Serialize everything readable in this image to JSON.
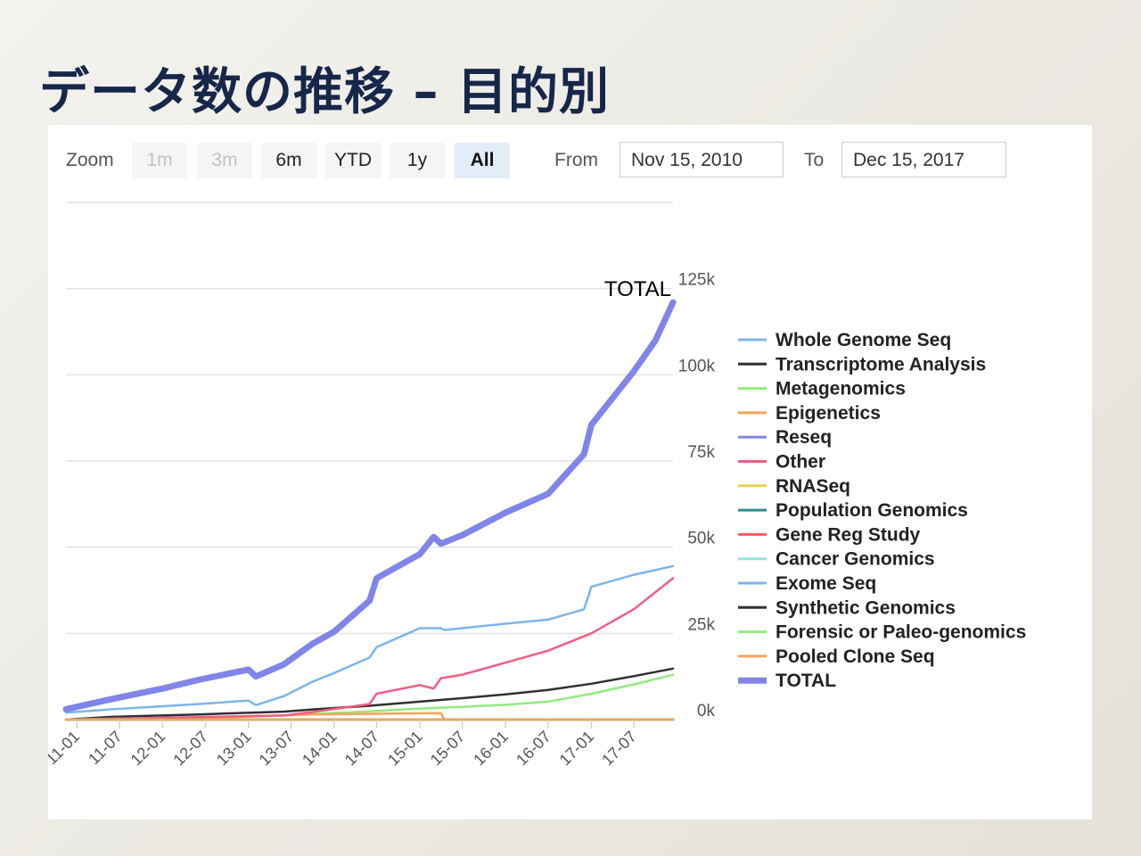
{
  "title": "データ数の推移 – 目的別",
  "toolbar": {
    "zoom_label": "Zoom",
    "buttons": [
      {
        "label": "1m",
        "state": "disabled"
      },
      {
        "label": "3m",
        "state": "disabled"
      },
      {
        "label": "6m",
        "state": "normal"
      },
      {
        "label": "YTD",
        "state": "normal"
      },
      {
        "label": "1y",
        "state": "normal"
      },
      {
        "label": "All",
        "state": "active"
      }
    ],
    "from_label": "From",
    "from_value": "Nov 15, 2010",
    "to_label": "To",
    "to_value": "Dec 15, 2017"
  },
  "chart_data": {
    "type": "line",
    "y_ticks": [
      "0k",
      "25k",
      "50k",
      "75k",
      "100k",
      "125k"
    ],
    "ylim": [
      0,
      150000
    ],
    "x_ticks": [
      "11-01",
      "11-07",
      "12-01",
      "12-07",
      "13-01",
      "13-07",
      "14-01",
      "14-07",
      "15-01",
      "15-07",
      "16-01",
      "16-07",
      "17-01",
      "17-07"
    ],
    "x_domain": [
      "2010-11-15",
      "2017-12-15"
    ],
    "first_tick_partial": "-01",
    "end_label": "TOTAL",
    "grid": true,
    "legend_position": "right",
    "series": [
      {
        "name": "Whole Genome Seq",
        "color": "#7cb5ec",
        "points": [
          [
            "2010-11-15",
            0
          ],
          [
            "2017-12-15",
            0
          ]
        ]
      },
      {
        "name": "Transcriptome Analysis",
        "color": "#2f2f36",
        "points": [
          [
            "2010-11-15",
            0
          ],
          [
            "2011-06-01",
            800
          ],
          [
            "2012-06-01",
            1500
          ],
          [
            "2013-06-01",
            2300
          ],
          [
            "2013-10-15",
            3000
          ],
          [
            "2014-06-01",
            4000
          ],
          [
            "2015-01-01",
            5200
          ],
          [
            "2015-07-01",
            6200
          ],
          [
            "2016-01-01",
            7300
          ],
          [
            "2016-07-01",
            8600
          ],
          [
            "2017-01-01",
            10400
          ],
          [
            "2017-07-01",
            12600
          ],
          [
            "2017-12-15",
            14800
          ]
        ]
      },
      {
        "name": "Metagenomics",
        "color": "#90ed7d",
        "points": [
          [
            "2010-11-15",
            0
          ],
          [
            "2013-06-01",
            1200
          ],
          [
            "2014-06-01",
            2400
          ],
          [
            "2015-01-01",
            3200
          ],
          [
            "2015-07-01",
            3700
          ],
          [
            "2016-01-01",
            4300
          ],
          [
            "2016-07-01",
            5200
          ],
          [
            "2017-01-01",
            7500
          ],
          [
            "2017-07-01",
            10200
          ],
          [
            "2017-12-15",
            13000
          ]
        ]
      },
      {
        "name": "Epigenetics",
        "color": "#f7a35c",
        "points": [
          [
            "2010-11-15",
            0
          ],
          [
            "2012-06-01",
            400
          ],
          [
            "2013-10-01",
            1500
          ],
          [
            "2015-04-01",
            1900
          ],
          [
            "2015-04-15",
            0
          ],
          [
            "2017-12-15",
            0
          ]
        ]
      },
      {
        "name": "Reseq",
        "color": "#8085e9",
        "points": [
          [
            "2010-11-15",
            0
          ],
          [
            "2017-12-15",
            0
          ]
        ]
      },
      {
        "name": "Other",
        "color": "#f15c80",
        "points": [
          [
            "2010-11-15",
            0
          ],
          [
            "2013-06-01",
            1200
          ],
          [
            "2013-10-01",
            2200
          ],
          [
            "2014-06-01",
            4500
          ],
          [
            "2014-07-01",
            7500
          ],
          [
            "2015-01-01",
            10000
          ],
          [
            "2015-03-01",
            9000
          ],
          [
            "2015-04-01",
            12000
          ],
          [
            "2015-07-01",
            13000
          ],
          [
            "2016-01-01",
            16500
          ],
          [
            "2016-07-01",
            20000
          ],
          [
            "2017-01-01",
            25000
          ],
          [
            "2017-07-01",
            32000
          ],
          [
            "2017-12-15",
            41000
          ]
        ]
      },
      {
        "name": "RNASeq",
        "color": "#e4d354",
        "points": [
          [
            "2010-11-15",
            0
          ],
          [
            "2017-12-15",
            0
          ]
        ]
      },
      {
        "name": "Population Genomics",
        "color": "#2b908f",
        "points": [
          [
            "2010-11-15",
            0
          ],
          [
            "2017-12-15",
            0
          ]
        ]
      },
      {
        "name": "Gene Reg Study",
        "color": "#f45b5b",
        "points": [
          [
            "2010-11-15",
            0
          ],
          [
            "2017-12-15",
            0
          ]
        ]
      },
      {
        "name": "Cancer Genomics",
        "color": "#91e8e1",
        "points": [
          [
            "2010-11-15",
            0
          ],
          [
            "2017-12-15",
            0
          ]
        ]
      },
      {
        "name": "Exome Seq",
        "color": "#7cb5ec",
        "points": [
          [
            "2010-11-15",
            2000
          ],
          [
            "2011-06-01",
            3000
          ],
          [
            "2012-06-01",
            4500
          ],
          [
            "2013-01-01",
            5500
          ],
          [
            "2013-02-01",
            4200
          ],
          [
            "2013-06-01",
            6800
          ],
          [
            "2013-10-01",
            11000
          ],
          [
            "2014-01-01",
            13500
          ],
          [
            "2014-06-01",
            18000
          ],
          [
            "2014-07-01",
            21000
          ],
          [
            "2015-01-01",
            26500
          ],
          [
            "2015-04-01",
            26500
          ],
          [
            "2015-04-15",
            26000
          ],
          [
            "2015-07-01",
            26500
          ],
          [
            "2016-01-01",
            27800
          ],
          [
            "2016-07-01",
            29000
          ],
          [
            "2016-12-01",
            32000
          ],
          [
            "2017-01-01",
            38500
          ],
          [
            "2017-07-01",
            42000
          ],
          [
            "2017-12-15",
            44500
          ]
        ]
      },
      {
        "name": "Synthetic Genomics",
        "color": "#2f2f36",
        "points": [
          [
            "2010-11-15",
            0
          ],
          [
            "2017-12-15",
            0
          ]
        ]
      },
      {
        "name": "Forensic or Paleo-genomics",
        "color": "#90ed7d",
        "points": [
          [
            "2010-11-15",
            0
          ],
          [
            "2017-12-15",
            0
          ]
        ]
      },
      {
        "name": "Pooled Clone Seq",
        "color": "#f7a35c",
        "points": [
          [
            "2010-11-15",
            0
          ],
          [
            "2017-12-15",
            0
          ]
        ]
      },
      {
        "name": "TOTAL",
        "color": "#8085e9",
        "points": [
          [
            "2010-11-15",
            3000
          ],
          [
            "2011-06-01",
            6000
          ],
          [
            "2012-01-01",
            9000
          ],
          [
            "2012-06-01",
            11500
          ],
          [
            "2013-01-01",
            14500
          ],
          [
            "2013-02-01",
            12500
          ],
          [
            "2013-06-01",
            16000
          ],
          [
            "2013-10-01",
            22000
          ],
          [
            "2014-01-01",
            25500
          ],
          [
            "2014-06-01",
            34500
          ],
          [
            "2014-07-01",
            41000
          ],
          [
            "2015-01-01",
            48000
          ],
          [
            "2015-03-01",
            53000
          ],
          [
            "2015-04-01",
            51000
          ],
          [
            "2015-07-01",
            53500
          ],
          [
            "2016-01-01",
            60000
          ],
          [
            "2016-07-01",
            65500
          ],
          [
            "2016-12-01",
            77000
          ],
          [
            "2017-01-01",
            85500
          ],
          [
            "2017-07-01",
            101000
          ],
          [
            "2017-10-01",
            110000
          ],
          [
            "2017-12-15",
            121000
          ]
        ]
      }
    ]
  }
}
